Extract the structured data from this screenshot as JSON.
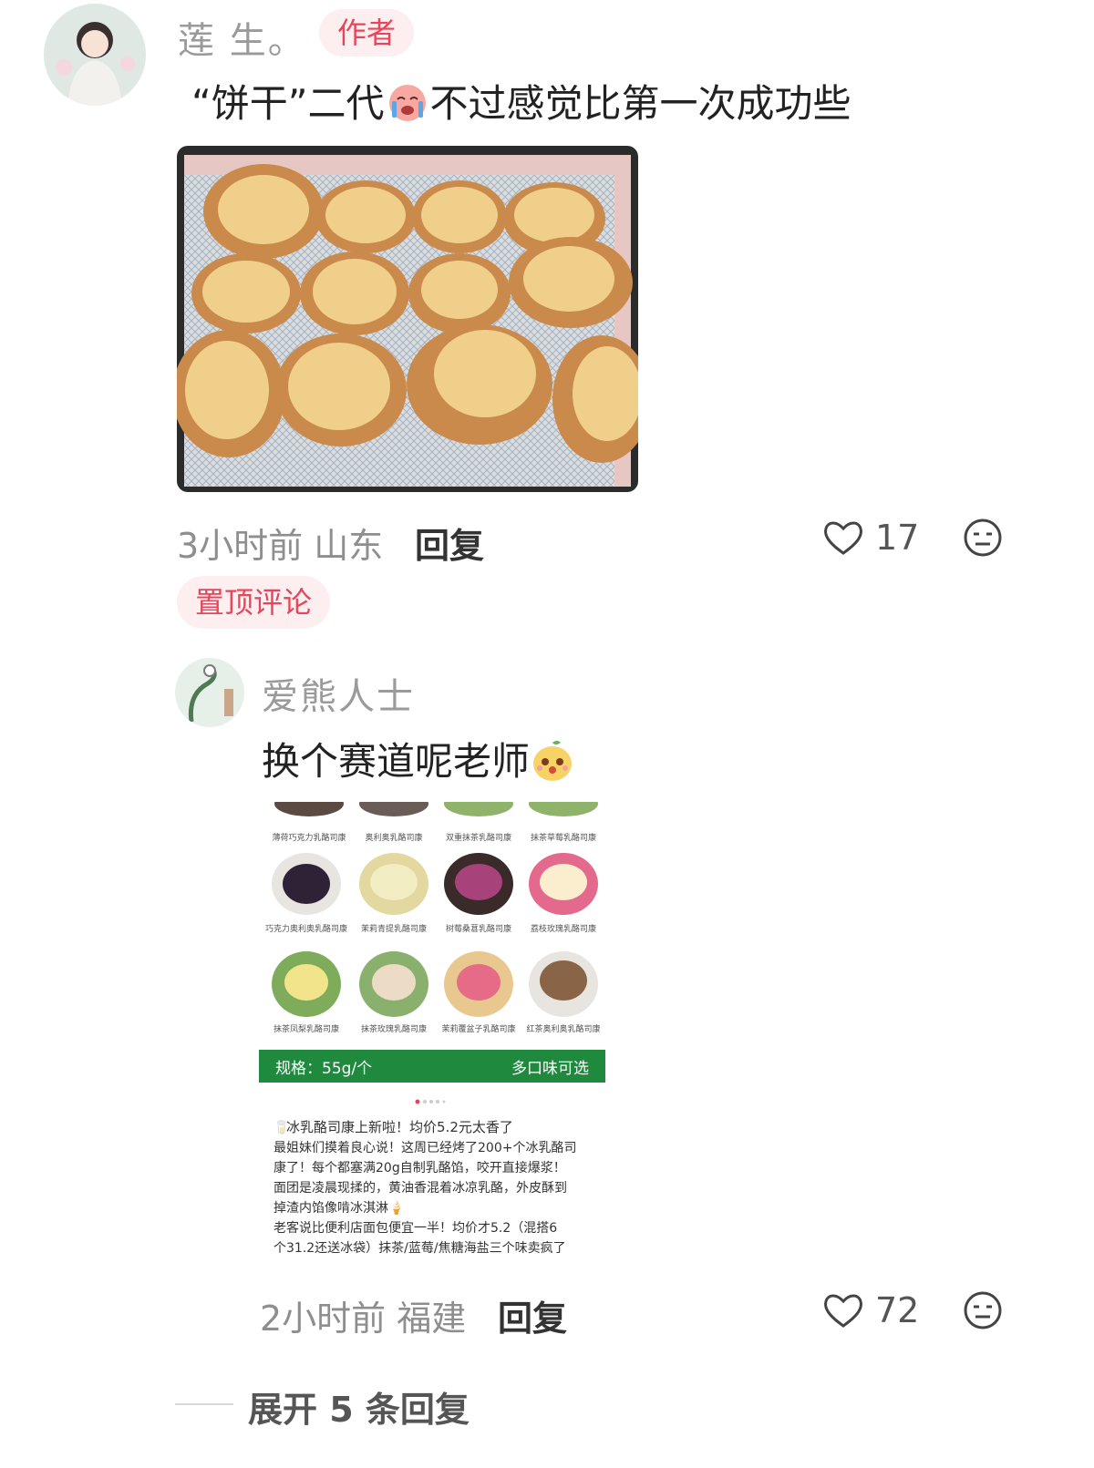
{
  "comment1": {
    "username": "莲 生。",
    "author_tag": "作者",
    "text_before_emoji": "“饼干”二代",
    "emoji_name": "crying-face-emoji",
    "text_after_emoji": "不过感觉比第一次成功些",
    "time_location": "3小时前 山东",
    "reply_label": "回复",
    "like_count": "17",
    "pinned_label": "置顶评论"
  },
  "comment2": {
    "username": "爱熊人士",
    "text_before_emoji": "换个赛道呢老师",
    "emoji_name": "cute-face-emoji",
    "time_location": "2小时前 福建",
    "reply_label": "回复",
    "like_count": "72",
    "ad_image": {
      "cookie_labels_row0": [
        "薄荷巧克力乳酪司康",
        "奥利奥乳酪司康",
        "双重抹茶乳酪司康",
        "抹茶草莓乳酪司康"
      ],
      "cookie_labels_row1": [
        "巧克力奥利奥乳酪司康",
        "茉莉青提乳酪司康",
        "树莓桑葚乳酪司康",
        "荔枝玫瑰乳酪司康"
      ],
      "cookie_labels_row2": [
        "抹茶凤梨乳酪司康",
        "抹茶玫瑰乳酪司康",
        "茉莉覆盆子乳酪司康",
        "红茶奥利奥乳酪司康"
      ],
      "spec_label": "规格：55g/个",
      "flavors_label": "多口味可选",
      "post_lines": [
        "冰乳酪司康上新啦！均价5.2元太香了",
        "最姐妹们摸着良心说！这周已经烤了200+个冰乳酪司",
        "康了！每个都塞满20g自制乳酪馅，咬开直接爆浆！",
        "面团是凌晨现揉的，黄油香混着冰凉乳酪，外皮酥到",
        "掉渣内馅像啃冰淇淋",
        "老客说比便利店面包便宜一半！均价才5.2（混搭6",
        "个31.2还送冰袋）抹茶/蓝莓/焦糖海盐三个味卖疯了"
      ]
    }
  },
  "expand_replies_label": "展开 5 条回复",
  "colors": {
    "accent": "#e8455a",
    "tag_bg": "#fdeef0",
    "green_banner": "#1f8a3e"
  }
}
